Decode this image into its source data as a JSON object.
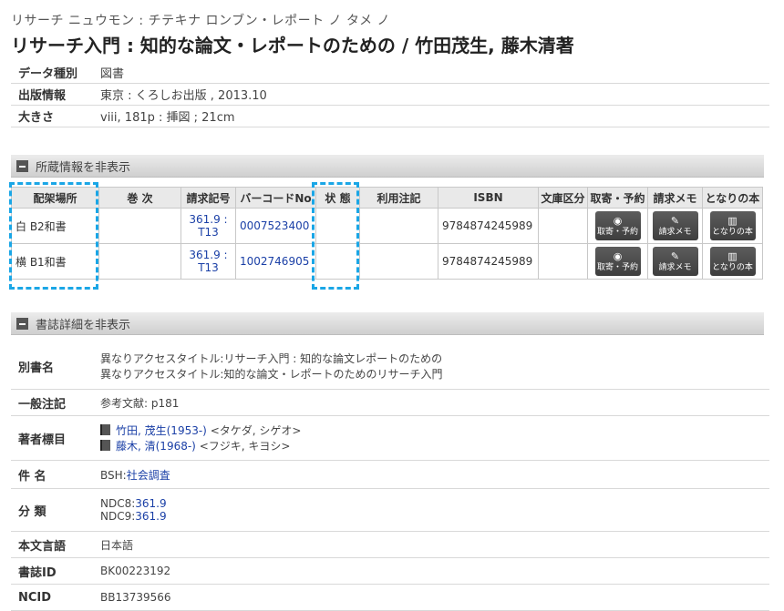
{
  "header": {
    "kana": "リサーチ ニュウモン : チテキナ ロンブン・レポート ノ タメ ノ",
    "title": "リサーチ入門 : 知的な論文・レポートのための / 竹田茂生, 藤木清著"
  },
  "meta": [
    {
      "label": "データ種別",
      "value": "図書"
    },
    {
      "label": "出版情報",
      "value": "東京 : くろしお出版 , 2013.10"
    },
    {
      "label": "大きさ",
      "value": "viii, 181p : 挿図 ; 21cm"
    }
  ],
  "holdings_section": {
    "label": "所蔵情報を非表示"
  },
  "holdings": {
    "headers": [
      "配架場所",
      "巻 次",
      "請求記号",
      "バーコードNo",
      "状 態",
      "利用注記",
      "ISBN",
      "文庫区分",
      "取寄・予約",
      "請求メモ",
      "となりの本"
    ],
    "rows": [
      {
        "location": "白 B2和書",
        "volume": "",
        "call_no": "361.9 : T13",
        "barcode": "0007523400",
        "status": "",
        "note": "",
        "isbn": "9784874245989",
        "bunko": ""
      },
      {
        "location": "横 B1和書",
        "volume": "",
        "call_no": "361.9 : T13",
        "barcode": "1002746905",
        "status": "",
        "note": "",
        "isbn": "9784874245989",
        "bunko": ""
      }
    ],
    "buttons": {
      "reserve": "取寄・予約",
      "memo": "請求メモ",
      "nextbook": "となりの本"
    }
  },
  "biblio_section": {
    "label": "書誌詳細を非表示"
  },
  "details": {
    "alt_title": {
      "label": "別書名",
      "lines": [
        "異なりアクセスタイトル:リサーチ入門 : 知的な論文レポートのための",
        "異なりアクセスタイトル:知的な論文・レポートのためのリサーチ入門"
      ]
    },
    "general_note": {
      "label": "一般注記",
      "value": "参考文献: p181"
    },
    "authors": {
      "label": "著者標目",
      "items": [
        {
          "name": "竹田, 茂生(1953-)",
          "reading": "<タケダ, シゲオ>"
        },
        {
          "name": "藤木, 清(1968-)",
          "reading": "<フジキ, キヨシ>"
        }
      ]
    },
    "subject": {
      "label": "件 名",
      "prefix": "BSH:",
      "value": "社会調査"
    },
    "classification": {
      "label": "分 類",
      "items": [
        {
          "prefix": "NDC8:",
          "value": "361.9"
        },
        {
          "prefix": "NDC9:",
          "value": "361.9"
        }
      ]
    },
    "language": {
      "label": "本文言語",
      "value": "日本語"
    },
    "biblio_id": {
      "label": "書誌ID",
      "value": "BK00223192"
    },
    "ncid": {
      "label": "NCID",
      "value": "BB13739566"
    }
  },
  "colors": {
    "link": "#1a3fa6",
    "highlight": "#1aa6e6",
    "button": "#4a4a4a"
  }
}
